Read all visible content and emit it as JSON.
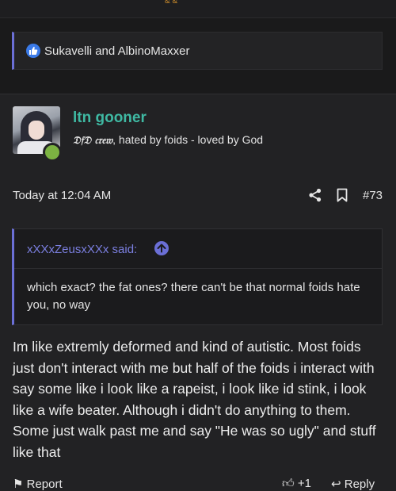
{
  "top": {
    "crumb": "& &"
  },
  "reactions": {
    "text": "Sukavelli and AlbinoMaxxer"
  },
  "post": {
    "username": "ltn gooner",
    "crew": "𝔇𝔣𝔇 𝔠𝔯𝔢𝔴",
    "title_rest": ", hated by foids - loved by God",
    "date": "Today at 12:04 AM",
    "number": "#73",
    "quote": {
      "author": "xXXxZeusxXXx said:",
      "text": "which exact? the fat ones? there can't be that normal foids hate you, no way"
    },
    "body": "Im like extremly deformed and kind of autistic. Most foids just don't interact with me but half of the foids i interact with say some like i look like a rapeist, i look like id stink, i look like a wife beater. Although i didn't do anything to them. Some just walk past me and say \"He was so ugly\" and stuff like that"
  },
  "footer": {
    "report_label": "Report",
    "like_count": "+1",
    "reply_label": "Reply"
  },
  "icons": {
    "like": "thumbs-up-icon",
    "share": "share-icon",
    "bookmark": "bookmark-icon",
    "quote_link": "arrow-up-circle-icon"
  },
  "colors": {
    "accent": "#6b6fd6",
    "username": "#3fb9a3",
    "online": "#7cb342",
    "like": "#3a7ae8"
  }
}
